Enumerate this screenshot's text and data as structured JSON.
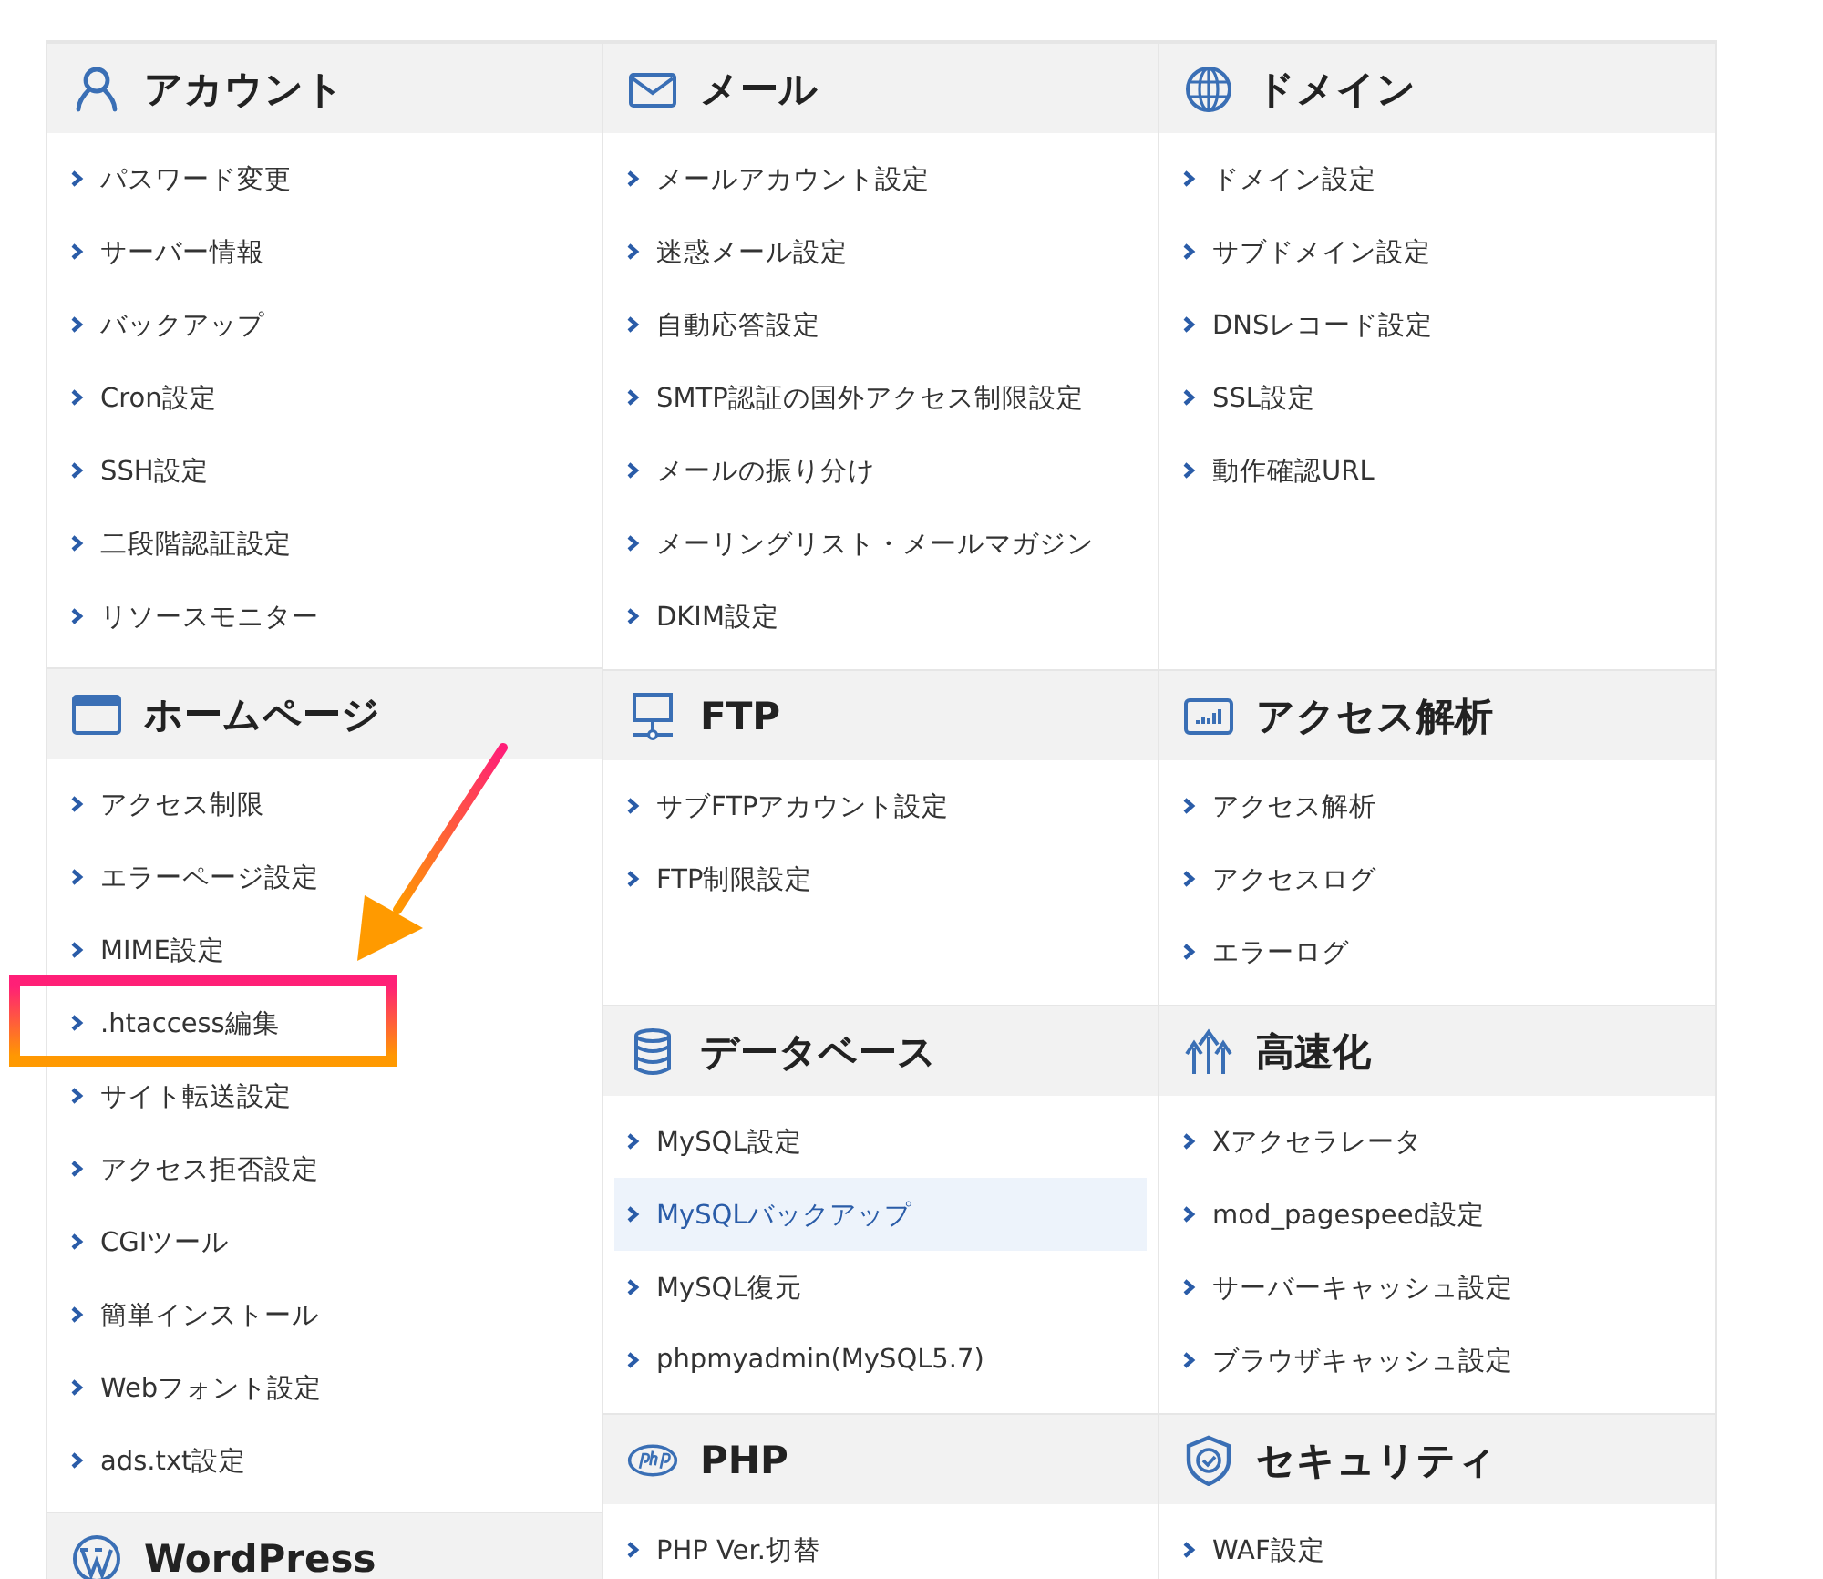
{
  "columns": [
    [
      {
        "title": "アカウント",
        "kind": "user",
        "items": [
          {
            "label": "パスワード変更",
            "selected": false
          },
          {
            "label": "サーバー情報",
            "selected": false
          },
          {
            "label": "バックアップ",
            "selected": false
          },
          {
            "label": "Cron設定",
            "selected": false
          },
          {
            "label": "SSH設定",
            "selected": false
          },
          {
            "label": "二段階認証設定",
            "selected": false
          },
          {
            "label": "リソースモニター",
            "selected": false
          }
        ]
      },
      {
        "title": "ホームページ",
        "kind": "window",
        "items": [
          {
            "label": "アクセス制限",
            "selected": false
          },
          {
            "label": "エラーページ設定",
            "selected": false
          },
          {
            "label": "MIME設定",
            "selected": false
          },
          {
            "label": ".htaccess編集",
            "selected": false
          },
          {
            "label": "サイト転送設定",
            "selected": false
          },
          {
            "label": "アクセス拒否設定",
            "selected": false
          },
          {
            "label": "CGIツール",
            "selected": false
          },
          {
            "label": "簡単インストール",
            "selected": false
          },
          {
            "label": "Webフォント設定",
            "selected": false
          },
          {
            "label": "ads.txt設定",
            "selected": false
          }
        ]
      },
      {
        "title": "WordPress",
        "kind": "wordpress"
      }
    ],
    [
      {
        "title": "メール",
        "kind": "mail",
        "items": [
          {
            "label": "メールアカウント設定",
            "selected": false
          },
          {
            "label": "迷惑メール設定",
            "selected": false
          },
          {
            "label": "自動応答設定",
            "selected": false
          },
          {
            "label": "SMTP認証の国外アクセス制限設定",
            "selected": false
          },
          {
            "label": "メールの振り分け",
            "selected": false
          },
          {
            "label": "メーリングリスト・メールマガジン",
            "selected": false
          },
          {
            "label": "DKIM設定",
            "selected": false
          }
        ]
      },
      {
        "title": "FTP",
        "kind": "monitor",
        "items": [
          {
            "label": "サブFTPアカウント設定",
            "selected": false
          },
          {
            "label": "FTP制限設定",
            "selected": false
          }
        ]
      },
      {
        "title": "データベース",
        "kind": "database",
        "items": [
          {
            "label": "MySQL設定",
            "selected": false
          },
          {
            "label": "MySQLバックアップ",
            "selected": true
          },
          {
            "label": "MySQL復元",
            "selected": false
          },
          {
            "label": "phpmyadmin(MySQL5.7)",
            "selected": false
          }
        ]
      },
      {
        "title": "PHP",
        "kind": "php",
        "items": [
          {
            "label": "PHP Ver.切替",
            "selected": false
          }
        ]
      }
    ],
    [
      {
        "title": "ドメイン",
        "kind": "globe",
        "items": [
          {
            "label": "ドメイン設定",
            "selected": false
          },
          {
            "label": "サブドメイン設定",
            "selected": false
          },
          {
            "label": "DNSレコード設定",
            "selected": false
          },
          {
            "label": "SSL設定",
            "selected": false
          },
          {
            "label": "動作確認URL",
            "selected": false
          }
        ]
      },
      {
        "title": "アクセス解析",
        "kind": "chart",
        "items": [
          {
            "label": "アクセス解析",
            "selected": false
          },
          {
            "label": "アクセスログ",
            "selected": false
          },
          {
            "label": "エラーログ",
            "selected": false
          }
        ]
      },
      {
        "title": "高速化",
        "kind": "speed",
        "items": [
          {
            "label": "Xアクセラレータ",
            "selected": false
          },
          {
            "label": "mod_pagespeed設定",
            "selected": false
          },
          {
            "label": "サーバーキャッシュ設定",
            "selected": false
          },
          {
            "label": "ブラウザキャッシュ設定",
            "selected": false
          }
        ]
      },
      {
        "title": "セキュリティ",
        "kind": "shield",
        "items": [
          {
            "label": "WAF設定",
            "selected": false
          }
        ]
      }
    ]
  ]
}
